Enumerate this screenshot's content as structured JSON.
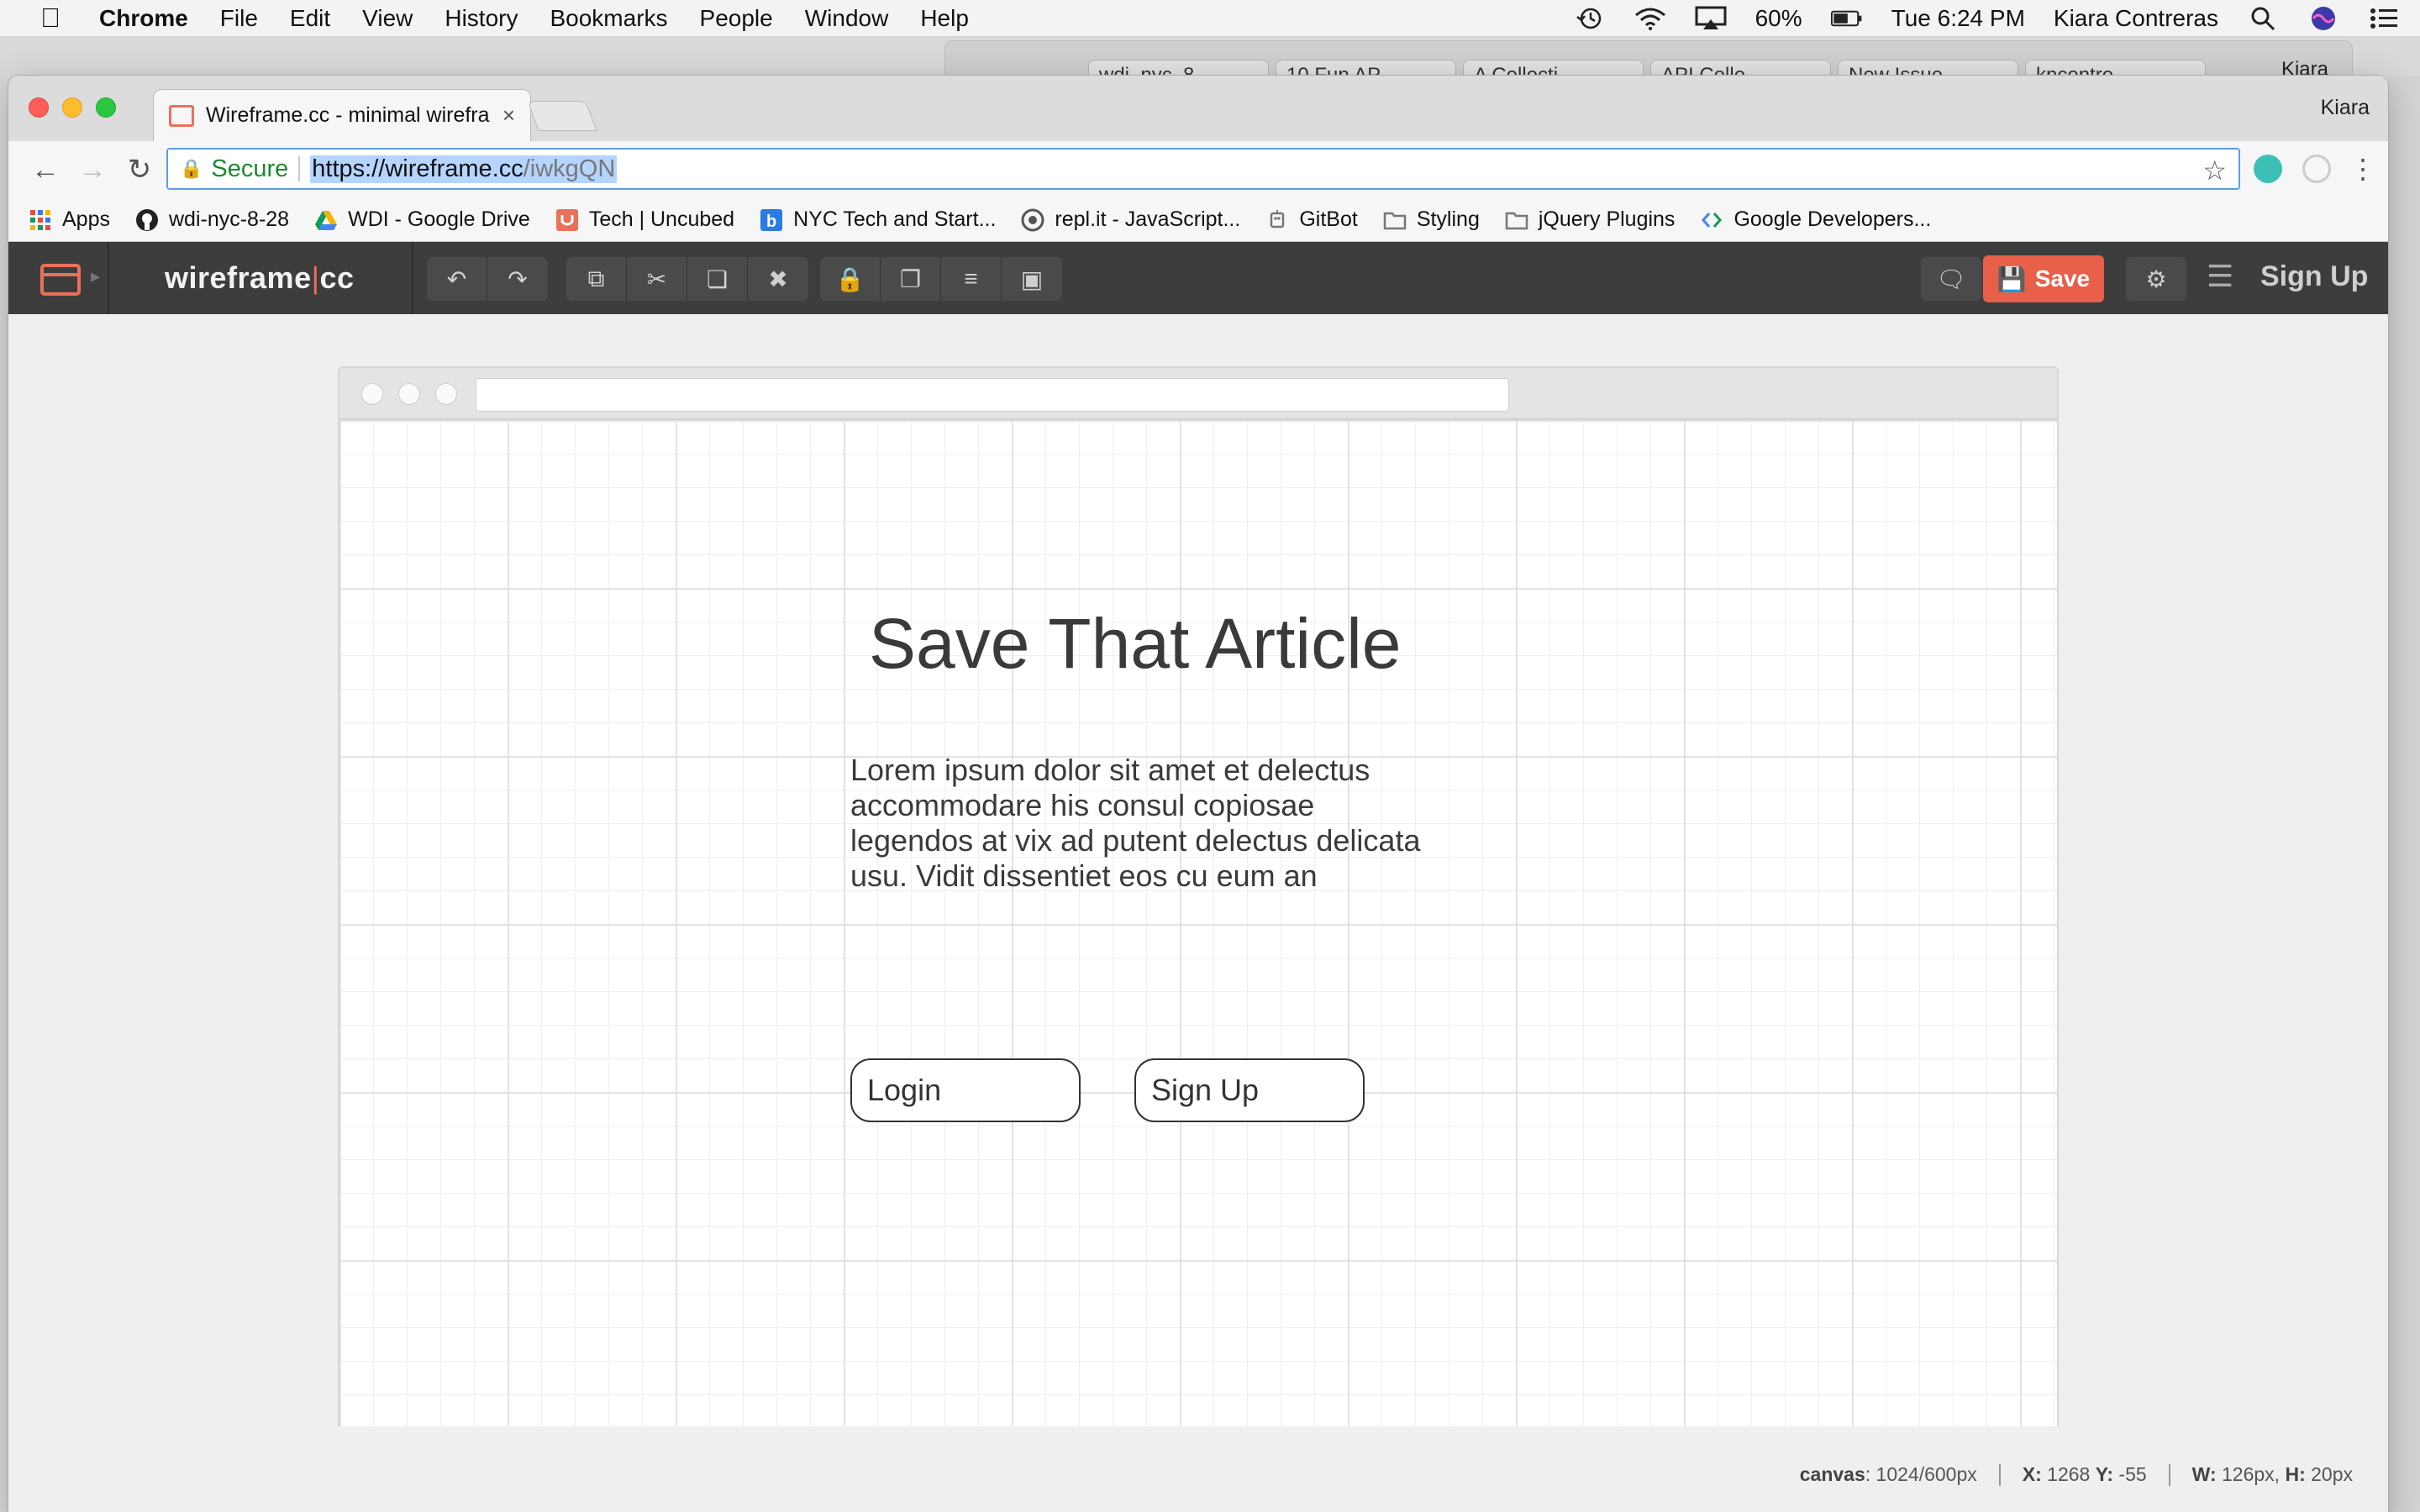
{
  "menubar": {
    "app": "Chrome",
    "items": [
      "File",
      "Edit",
      "View",
      "History",
      "Bookmarks",
      "People",
      "Window",
      "Help"
    ],
    "battery": "60%",
    "clock": "Tue 6:24 PM",
    "user": "Kiara Contreras"
  },
  "background_window": {
    "tabs": [
      "wdi_nyc_8",
      "10 Fun AP",
      "A Collecti",
      "API Colle",
      "New Issue",
      "kncontre"
    ],
    "user": "Kiara"
  },
  "browser": {
    "tab_title": "Wireframe.cc - minimal wirefra",
    "profile": "Kiara",
    "secure_label": "Secure",
    "url_scheme_host": "https://wireframe.cc",
    "url_path": "/iwkgQN"
  },
  "bookmarks": [
    {
      "label": "Apps",
      "icon": "apps-grid-icon",
      "color": "#e84c3d"
    },
    {
      "label": "wdi-nyc-8-28",
      "icon": "github-icon",
      "color": "#222222"
    },
    {
      "label": "WDI - Google Drive",
      "icon": "google-drive-icon",
      "color": "#1fa463"
    },
    {
      "label": "Tech | Uncubed",
      "icon": "uncubed-icon",
      "color": "#e8715a"
    },
    {
      "label": "NYC Tech and Start...",
      "icon": "b-icon",
      "color": "#2c7be5"
    },
    {
      "label": "repl.it - JavaScript...",
      "icon": "replit-icon",
      "color": "#555555"
    },
    {
      "label": "GitBot",
      "icon": "gitbot-icon",
      "color": "#777777"
    },
    {
      "label": "Styling",
      "icon": "folder-icon",
      "color": "#888888"
    },
    {
      "label": "jQuery Plugins",
      "icon": "folder-icon",
      "color": "#888888"
    },
    {
      "label": "Google Developers...",
      "icon": "google-dev-icon",
      "color": "#4285f4"
    }
  ],
  "app": {
    "logo_left": "wireframe",
    "logo_sep": "|",
    "logo_right": "cc",
    "save_label": "Save",
    "signup_label": "Sign Up",
    "accent_color": "#e8604a"
  },
  "wireframe": {
    "title": "Save That Article",
    "body": "Lorem ipsum dolor sit amet et delectus accommodare his consul copiosae legendos at vix ad putent delectus delicata usu. Vidit dissentiet eos cu eum an",
    "buttons": [
      "Login",
      "Sign Up"
    ]
  },
  "status": {
    "canvas_label": "canvas",
    "canvas_value": ": 1024/600px",
    "x_label": "X:",
    "x_value": "1268",
    "y_label": "Y:",
    "y_value": "-55",
    "w_label": "W:",
    "w_value": "126px,",
    "h_label": "H:",
    "h_value": "20px"
  }
}
